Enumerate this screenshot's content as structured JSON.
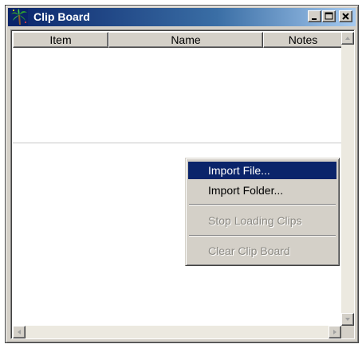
{
  "window": {
    "title": "Clip Board",
    "icon": "palm-tree-icon"
  },
  "caption_buttons": {
    "minimize": "minimize-icon",
    "maximize": "maximize-icon",
    "close": "close-icon"
  },
  "list": {
    "columns": [
      "Item",
      "Name",
      "Notes"
    ],
    "rows": []
  },
  "context_menu": {
    "items": [
      {
        "label": "Import File...",
        "state": "highlighted"
      },
      {
        "label": "Import Folder...",
        "state": "enabled"
      },
      {
        "label": "Stop Loading Clips",
        "state": "disabled"
      },
      {
        "label": "Clear Clip Board",
        "state": "disabled"
      }
    ]
  },
  "colors": {
    "title_gradient_start": "#0a246a",
    "title_gradient_end": "#a6caf0",
    "menu_highlight": "#0a246a",
    "face": "#d4d0c8"
  }
}
